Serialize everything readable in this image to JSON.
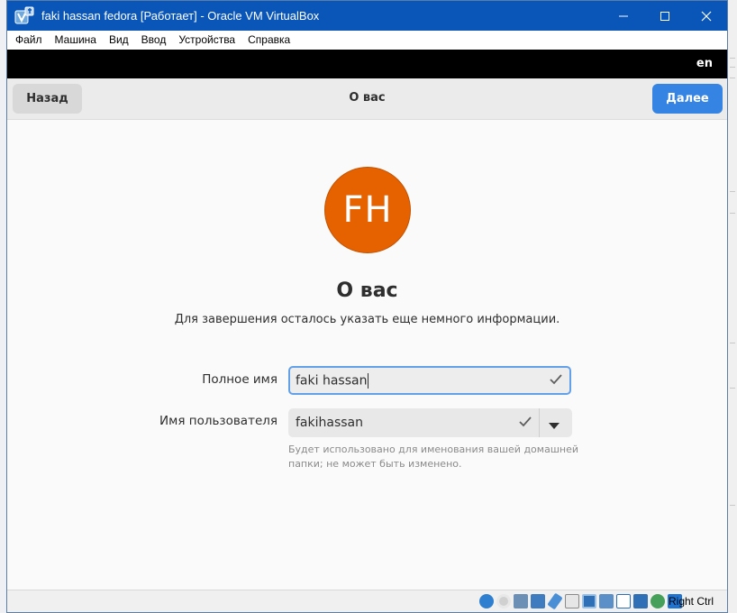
{
  "window": {
    "title": "faki hassan fedora [Работает] - Oracle VM VirtualBox",
    "app_icon": "virtualbox-icon",
    "controls": [
      "minimize-icon",
      "maximize-icon",
      "close-icon"
    ]
  },
  "menubar": {
    "items": [
      "Файл",
      "Машина",
      "Вид",
      "Ввод",
      "Устройства",
      "Справка"
    ]
  },
  "guest": {
    "top_panel": {
      "language": "en"
    },
    "header": {
      "back_label": "Назад",
      "title": "О вас",
      "next_label": "Далее"
    },
    "avatar": {
      "initials": "FH",
      "color": "#e66100"
    },
    "page_title": "О вас",
    "subtitle": "Для завершения осталось указать еще немного информации.",
    "form": {
      "full_name": {
        "label": "Полное имя",
        "value": "faki hassan",
        "valid": true
      },
      "username": {
        "label": "Имя пользователя",
        "value": "fakihassan",
        "valid": true
      },
      "hint": "Будет использовано для именования вашей домашней папки; не может быть изменено."
    }
  },
  "statusbar": {
    "icons": [
      "hard-disk-icon",
      "optical-drive-icon",
      "audio-icon",
      "network-icon",
      "usb-icon",
      "shared-folders-icon",
      "display-icon",
      "video-capture-icon",
      "virtualization-icon",
      "cpu-icon",
      "mouse-integration-icon",
      "keyboard-icon"
    ],
    "host_key": "Right Ctrl"
  },
  "colors": {
    "titlebar": "#0a56b8",
    "accent": "#3584e4",
    "focus": "#62a0ea"
  }
}
